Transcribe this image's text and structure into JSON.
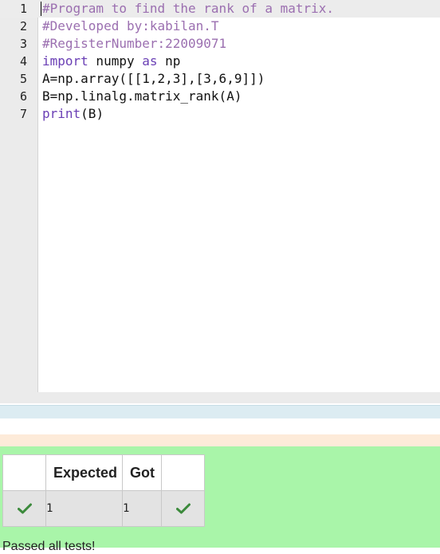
{
  "editor": {
    "lines": [
      {
        "num": "1",
        "text": "#Program to find the rank of a matrix."
      },
      {
        "num": "2",
        "text": "#Developed by:kabilan.T"
      },
      {
        "num": "3",
        "text": "#RegisterNumber:22009071"
      },
      {
        "num": "4",
        "kw1": "import",
        "mid": " numpy ",
        "kw2": "as",
        "end": " np"
      },
      {
        "num": "5",
        "text": "A=np.array([[1,2,3],[3,6,9]])"
      },
      {
        "num": "6",
        "text": "B=np.linalg.matrix_rank(A)"
      },
      {
        "num": "7",
        "fn": "print",
        "rest": "(B)"
      }
    ]
  },
  "results": {
    "headers": [
      "",
      "Expected",
      "Got",
      ""
    ],
    "rows": [
      {
        "pass_icon": "check-icon",
        "expected": "1",
        "got": "1",
        "got_icon": "check-icon"
      }
    ],
    "check_color": "#3c8a3c"
  },
  "footer": {
    "text": "Passed all tests!"
  },
  "colors": {
    "result_bg": "#a9f5a9",
    "blue_band": "#dcecf2",
    "peach_band": "#fdebd9",
    "comment": "#9b6fb0",
    "keyword": "#6a3fb5"
  }
}
